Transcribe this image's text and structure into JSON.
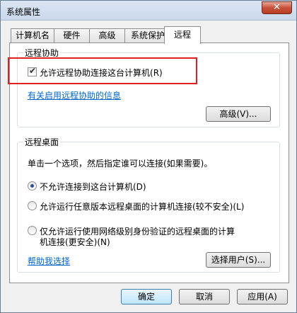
{
  "window": {
    "title": "系统属性",
    "close_label": "✕"
  },
  "tabs": [
    "计算机名",
    "硬件",
    "高级",
    "系统保护",
    "远程"
  ],
  "remote_assistance": {
    "group_title": "远程协助",
    "allow_label": "允许远程协助连接这台计算机",
    "allow_shortcut": "(R)",
    "allow_checked": true,
    "info_link": "有关启用远程协助的信息",
    "advanced_button": "高级(V)..."
  },
  "remote_desktop": {
    "group_title": "远程桌面",
    "instruction": "单击一个选项，然后指定谁可以连接(如果需要)。",
    "options": [
      {
        "label": "不允许连接到这台计算机(D)",
        "selected": true
      },
      {
        "label": "允许运行任意版本远程桌面的计算机连接(较不安全)(L)",
        "selected": false
      },
      {
        "label_line1": "仅允许运行使用网络级别身份验证的远程桌面的计算",
        "label_line2": "机连接(更安全)(N)",
        "selected": false
      }
    ],
    "help_link": "帮助我选择",
    "select_users_button": "选择用户(S)..."
  },
  "footer": {
    "ok": "确定",
    "cancel": "取消",
    "apply": "应用(A)"
  }
}
